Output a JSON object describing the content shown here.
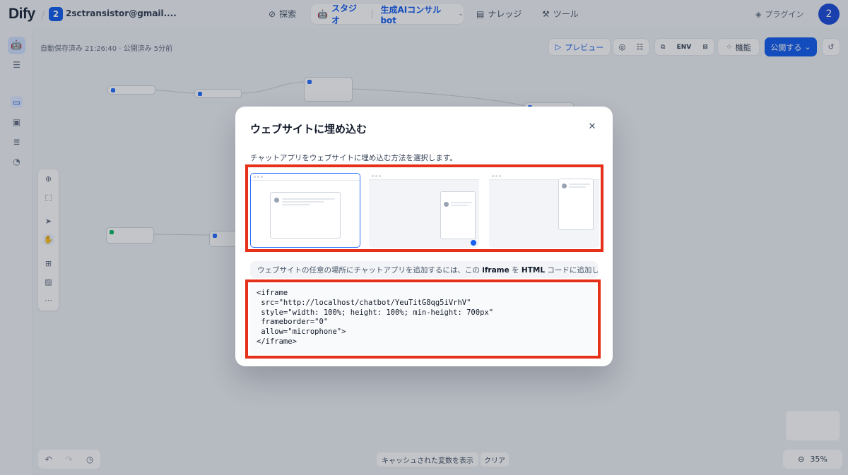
{
  "topbar": {
    "logo": "Dify",
    "workspace_badge": "2",
    "workspace_name": "2sctransistor@gmail....",
    "nav_explore": "探索",
    "nav_studio": "スタジオ",
    "nav_app": "生成AIコンサルbot",
    "nav_knowledge": "ナレッジ",
    "nav_tools": "ツール",
    "plugin": "プラグイン",
    "avatar": "2"
  },
  "workflow": {
    "autosave": "自動保存済み 21:26:40 · 公開済み 5分前",
    "preview": "プレビュー",
    "env_label": "ENV",
    "features": "機能",
    "publish": "公開する",
    "show_cached_vars": "キャッシュされた変数を表示",
    "clear": "クリア",
    "zoom": "35%"
  },
  "modal": {
    "title": "ウェブサイトに埋め込む",
    "description": "チャットアプリをウェブサイトに埋め込む方法を選択します。",
    "instruction_pre": "ウェブサイトの任意の場所にチャットアプリを追加するには、この ",
    "instruction_iframe": "iframe",
    "instruction_mid": " を ",
    "instruction_html": "HTML",
    "instruction_post": " コードに追加してく",
    "code": "<iframe\n src=\"http://localhost/chatbot/YeuTitG8qg5iVrhV\"\n style=\"width: 100%; height: 100%; min-height: 700px\"\n frameborder=\"0\"\n allow=\"microphone\">\n</iframe>",
    "selected_option": 1
  },
  "colors": {
    "accent": "#155eef",
    "highlight_frame": "#e5301a"
  }
}
